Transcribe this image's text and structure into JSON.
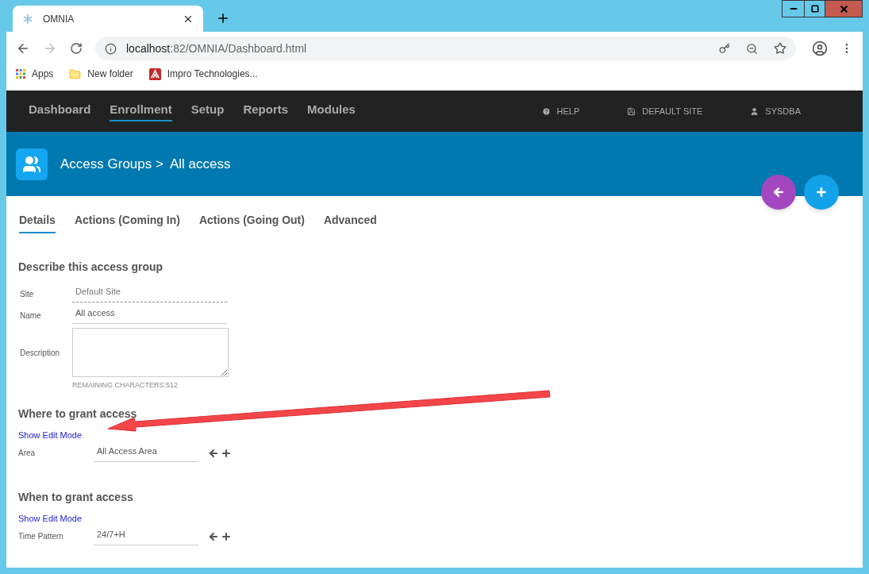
{
  "browser": {
    "tab_title": "OMNIA",
    "url_host": "localhost",
    "url_path": ":82/OMNIA/Dashboard.html",
    "bookmarks": [
      {
        "kind": "apps",
        "label": "Apps"
      },
      {
        "kind": "folder",
        "label": "New folder"
      },
      {
        "kind": "site",
        "label": "Impro Technologies..."
      }
    ]
  },
  "nav": {
    "items": [
      {
        "label": "Dashboard",
        "selected": false
      },
      {
        "label": "Enrollment",
        "selected": true
      },
      {
        "label": "Setup",
        "selected": false
      },
      {
        "label": "Reports",
        "selected": false
      },
      {
        "label": "Modules",
        "selected": false
      }
    ],
    "right": [
      {
        "kind": "help",
        "label": "HELP"
      },
      {
        "kind": "site",
        "label": "DEFAULT SITE"
      },
      {
        "kind": "user",
        "label": "SYSDBA"
      }
    ]
  },
  "header": {
    "breadcrumb": "Access Groups >",
    "title": "All access"
  },
  "tabs": [
    {
      "label": "Details",
      "selected": true
    },
    {
      "label": "Actions (Coming In)",
      "selected": false
    },
    {
      "label": "Actions (Going Out)",
      "selected": false
    },
    {
      "label": "Advanced",
      "selected": false
    }
  ],
  "describe": {
    "heading": "Describe this access group",
    "site": {
      "label": "Site",
      "value": "Default Site"
    },
    "name": {
      "label": "Name",
      "value": "All access"
    },
    "description": {
      "label": "Description",
      "remaining": "REMAINING CHARACTERS:512"
    }
  },
  "sections": [
    {
      "heading": "Where to grant access",
      "link": "Show Edit Mode",
      "field_label": "Area",
      "value": "All Access Area"
    },
    {
      "heading": "When to grant access",
      "link": "Show Edit Mode",
      "field_label": "Time Pattern",
      "value": "24/7+H"
    }
  ]
}
